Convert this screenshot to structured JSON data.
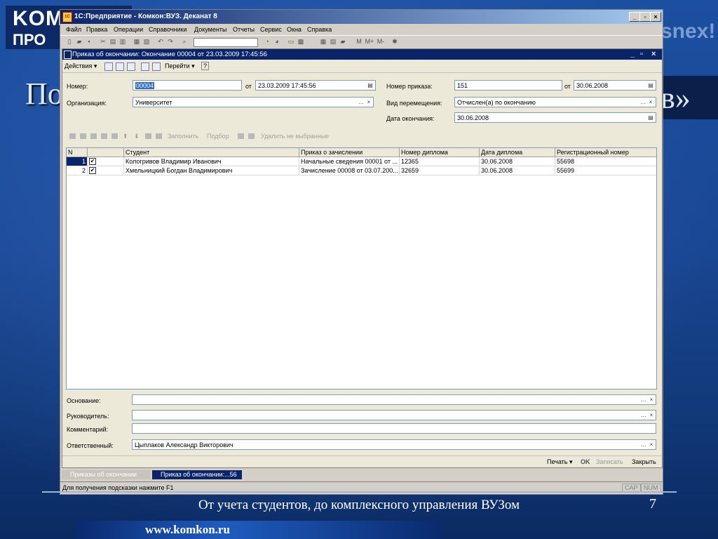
{
  "slide": {
    "logo_line1": "KOM",
    "logo_line2": "ПРО",
    "heading_left": "По",
    "heading_right": "в»",
    "bg_right_text": "snex!",
    "footer_text": "От учета студентов, до комплексного управления ВУЗом",
    "page_number": "7",
    "site": "www.komkon.ru"
  },
  "app": {
    "icon_text": "1C",
    "title": "1С:Предприятие - Комкон:ВУЗ. Деканат 8",
    "window_buttons": [
      "_",
      "▫",
      "×"
    ],
    "menu": [
      "Файл",
      "Правка",
      "Операции",
      "Справочники",
      "Документы",
      "Отчеты",
      "Сервис",
      "Окна",
      "Справка"
    ],
    "toolbar_letters": [
      "M",
      "M+",
      "M-"
    ]
  },
  "doc": {
    "title": "Приказ об окончании: Окончание 00004 от 23.03.2009 17:45:56",
    "toolbar": {
      "actions": "Действия ▾",
      "goto": "Перейти ▾",
      "help": "?"
    },
    "fields": {
      "number_label": "Номер:",
      "number_value": "00004",
      "from_label": "от",
      "date_value": "23.03.2009 17:45:56",
      "org_label": "Организация:",
      "org_value": "Университет",
      "order_num_label": "Номер приказа:",
      "order_num_value": "151",
      "order_from_label": "от",
      "order_date_value": "30.06.2008",
      "move_type_label": "Вид перемещения:",
      "move_type_value": "Отчислен(а) по окончанию",
      "end_date_label": "Дата окончания:",
      "end_date_value": "30.06.2008"
    },
    "table_toolbar": {
      "fill": "Заполнить",
      "pick": "Подбор",
      "delete_unselected": "Удалить не выбранные"
    },
    "table": {
      "headers": [
        "N",
        "",
        "Студент",
        "Приказ о зачислении",
        "Номер диплома",
        "Дата диплома",
        "Регистрационный номер"
      ],
      "rows": [
        {
          "n": "1",
          "checked": "✔",
          "student": "Кологривов Владимир Иванович",
          "enroll_order": "Начальные сведения 00001 от ...",
          "diploma_no": "12365",
          "diploma_date": "30.06.2008",
          "reg_no": "55698"
        },
        {
          "n": "2",
          "checked": "✔",
          "student": "Хмельницкий Богдан Владимирович",
          "enroll_order": "Зачисление 00008 от 03.07.200...",
          "diploma_no": "32659",
          "diploma_date": "30.06.2008",
          "reg_no": "55699"
        }
      ]
    },
    "bottom_fields": {
      "basis_label": "Основание:",
      "basis_value": "",
      "head_label": "Руководитель:",
      "head_value": "",
      "comment_label": "Комментарий:",
      "comment_value": "",
      "responsible_label": "Ответственный:",
      "responsible_value": "Цыплаков Александр Викторович"
    },
    "bottom_buttons": {
      "print": "Печать ▾",
      "ok": "OK",
      "save": "Записать",
      "close": "Закрыть"
    }
  },
  "taskbar": {
    "tab1": "Приказы об окончании",
    "tab2": "Приказ об окончании:...56"
  },
  "status": {
    "hint": "Для получения подсказки нажмите F1",
    "cap": "CAP",
    "num": "NUM"
  }
}
